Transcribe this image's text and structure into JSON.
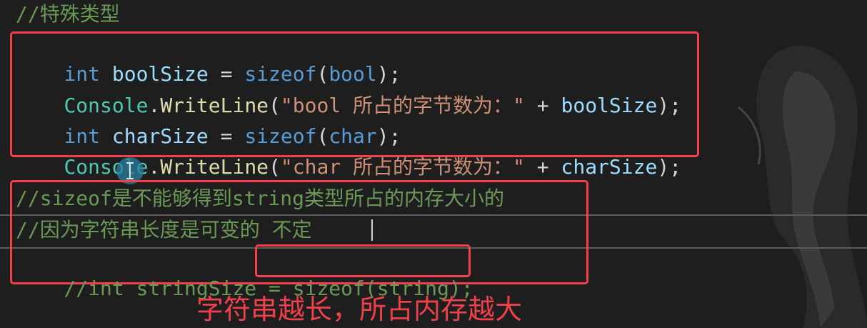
{
  "editor": {
    "comment_header": "//特殊类型",
    "box1": {
      "line1": {
        "kw1": "int",
        "var": " boolSize",
        "op": " = ",
        "fn": "sizeof",
        "p1": "(",
        "kw2": "bool",
        "p2": ");"
      },
      "line2": {
        "cls": "Console",
        "dot": ".",
        "fn": "WriteLine",
        "p1": "(",
        "str": "\"bool 所占的字节数为：\"",
        "op": " + ",
        "var": "boolSize",
        "p2": ");"
      },
      "line3": {
        "kw1": "int",
        "var": " charSize",
        "op": " = ",
        "fn": "sizeof",
        "p1": "(",
        "kw2": "char",
        "p2": ");"
      },
      "line4": {
        "cls": "Console",
        "dot": ".",
        "fn": "WriteLine",
        "p1": "(",
        "str": "\"char 所占的字节数为：\"",
        "op": " + ",
        "var": "charSize",
        "p2": ");"
      }
    },
    "box2": {
      "comment1": "//sizeof是不能够得到string类型所占的内存大小的",
      "comment2": "//因为字符串长度是可变的 不定",
      "comment3_prefix": "//int stringSize = ",
      "comment3_boxed": "sizeof(string);"
    }
  },
  "annotation": {
    "text": "字符串越长，所占内存越大"
  }
}
